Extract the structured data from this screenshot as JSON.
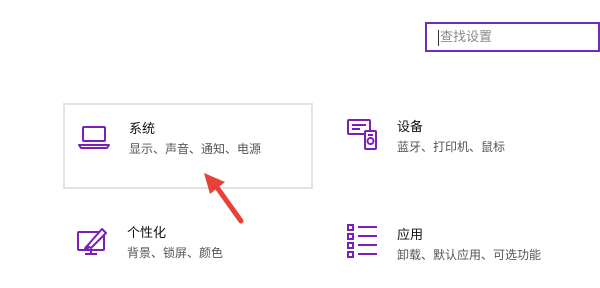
{
  "search": {
    "placeholder": "查找设置"
  },
  "tiles": [
    {
      "title": "系统",
      "description": "显示、声音、通知、电源",
      "icon": "laptop-icon"
    },
    {
      "title": "设备",
      "description": "蓝牙、打印机、鼠标",
      "icon": "devices-icon"
    },
    {
      "title": "个性化",
      "description": "背景、锁屏、颜色",
      "icon": "personalization-icon"
    },
    {
      "title": "应用",
      "description": "卸载、默认应用、可选功能",
      "icon": "apps-list-icon"
    }
  ],
  "colors": {
    "accent": "#7a1fb8",
    "search_border": "#6f2cbb",
    "arrow": "#e8413a"
  }
}
